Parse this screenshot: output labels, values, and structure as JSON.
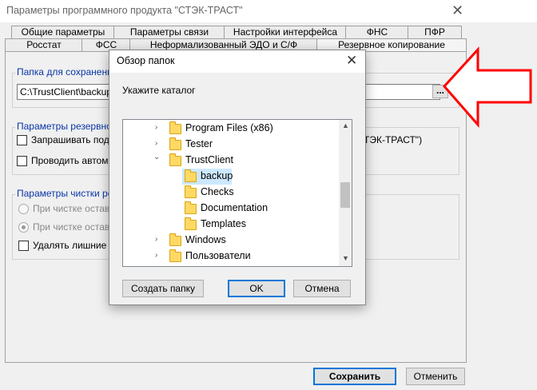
{
  "window": {
    "title": "Параметры программного продукта \"СТЭК-ТРАСТ\"",
    "close_glyph": "✕"
  },
  "tabs_row1": [
    "Общие параметры",
    "Параметры связи",
    "Настройки интерфейса",
    "ФНС",
    "ПФР"
  ],
  "tabs_row2": [
    "Росстат",
    "ФСС",
    "Неформализованный ЭДО и С/Ф",
    "Резервное копирование"
  ],
  "groups": {
    "save_folder": {
      "legend": "Папка для сохранения",
      "path": "C:\\TrustClient\\backup",
      "browse": "..."
    },
    "backup_params": {
      "legend": "Параметры резервно",
      "items": [
        "Запрашивать подте",
        "Проводить автомат"
      ],
      "right_text": "ТЭК-ТРАСТ\")"
    },
    "clean_params": {
      "legend": "Параметры чистки рез",
      "radio1": "При чистке оставл",
      "radio2": "При чистке оставл",
      "check": "Удалять лишние к"
    }
  },
  "dialog": {
    "title": "Обзор папок",
    "close_glyph": "✕",
    "prompt": "Укажите каталог",
    "tree": [
      {
        "name": "Program Files (x86)",
        "chev": "›",
        "level": 0,
        "selected": false
      },
      {
        "name": "Tester",
        "chev": "›",
        "level": 0,
        "selected": false
      },
      {
        "name": "TrustClient",
        "chev": "⌄",
        "level": 0,
        "selected": false
      },
      {
        "name": "backup",
        "chev": "",
        "level": 1,
        "selected": true
      },
      {
        "name": "Checks",
        "chev": "",
        "level": 1,
        "selected": false
      },
      {
        "name": "Documentation",
        "chev": "",
        "level": 1,
        "selected": false
      },
      {
        "name": "Templates",
        "chev": "",
        "level": 1,
        "selected": false
      },
      {
        "name": "Windows",
        "chev": "›",
        "level": 0,
        "selected": false
      },
      {
        "name": "Пользователи",
        "chev": "›",
        "level": 0,
        "selected": false
      }
    ],
    "buttons": {
      "new_folder": "Создать папку",
      "ok": "OK",
      "cancel": "Отмена"
    }
  },
  "footer": {
    "save": "Сохранить",
    "cancel": "Отменить"
  },
  "colors": {
    "legend": "#0a36a8",
    "selection": "#cce8ff",
    "arrow": "#ff0000",
    "focus_border": "#0078d7"
  }
}
